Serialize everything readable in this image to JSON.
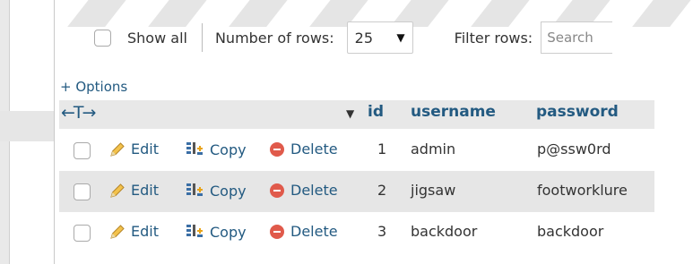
{
  "controls": {
    "show_all_label": "Show all",
    "rows_label": "Number of rows:",
    "rows_value": "25",
    "filter_label": "Filter rows:",
    "filter_placeholder": "Search"
  },
  "options_link": "+ Options",
  "table": {
    "columns": [
      "id",
      "username",
      "password"
    ],
    "row_actions": {
      "edit": "Edit",
      "copy": "Copy",
      "delete": "Delete"
    },
    "rows": [
      {
        "id": "1",
        "username": "admin",
        "password": "p@ssw0rd"
      },
      {
        "id": "2",
        "username": "jigsaw",
        "password": "footworklure"
      },
      {
        "id": "3",
        "username": "backdoor",
        "password": "backdoor"
      }
    ]
  },
  "colors": {
    "link": "#235a81",
    "stripe_row": "#e6e6e6",
    "delete_icon": "#e05a4b"
  }
}
